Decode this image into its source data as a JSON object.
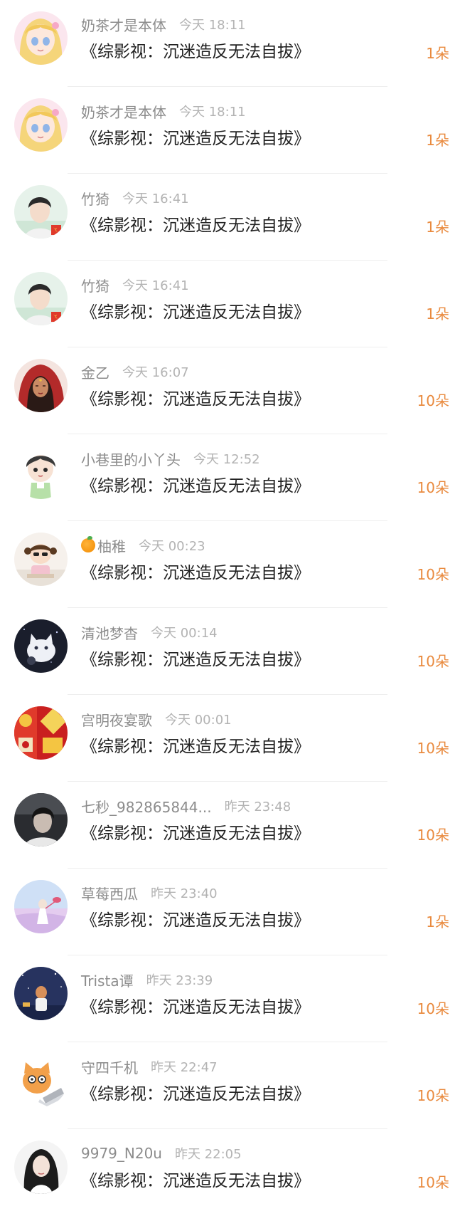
{
  "items": [
    {
      "name": "奶茶才是本体",
      "time": "今天 18:11",
      "title": "《综影视：沉迷造反无法自拔》",
      "gift": "1朵",
      "avatar": "anime-girl-pink"
    },
    {
      "name": "奶茶才是本体",
      "time": "今天 18:11",
      "title": "《综影视：沉迷造反无法自拔》",
      "gift": "1朵",
      "avatar": "anime-girl-pink"
    },
    {
      "name": "竹猗",
      "time": "今天 16:41",
      "title": "《综影视：沉迷造反无法自拔》",
      "gift": "1朵",
      "avatar": "young-man-green"
    },
    {
      "name": "竹猗",
      "time": "今天 16:41",
      "title": "《综影视：沉迷造反无法自拔》",
      "gift": "1朵",
      "avatar": "young-man-green"
    },
    {
      "name": "金乙",
      "time": "今天 16:07",
      "title": "《综影视：沉迷造反无法自拔》",
      "gift": "10朵",
      "avatar": "woman-red-veil"
    },
    {
      "name": "小巷里的小丫头",
      "time": "今天 12:52",
      "title": "《综影视：沉迷造反无法自拔》",
      "gift": "10朵",
      "avatar": "chibi-boy"
    },
    {
      "name": "柚稚",
      "name_emoji": "orange",
      "time": "今天 00:23",
      "title": "《综影视：沉迷造反无法自拔》",
      "gift": "10朵",
      "avatar": "cartoon-girl"
    },
    {
      "name": "清池梦杳",
      "time": "今天 00:14",
      "title": "《综影视：沉迷造反无法自拔》",
      "gift": "10朵",
      "avatar": "white-cat"
    },
    {
      "name": "宫明夜宴歌",
      "time": "今天 00:01",
      "title": "《综影视：沉迷造反无法自拔》",
      "gift": "10朵",
      "avatar": "red-festive"
    },
    {
      "name": "七秒_982865844...",
      "time": "昨天 23:48",
      "title": "《综影视：沉迷造反无法自拔》",
      "gift": "10朵",
      "avatar": "dark-portrait"
    },
    {
      "name": "草莓西瓜",
      "time": "昨天 23:40",
      "title": "《综影视：沉迷造反无法自拔》",
      "gift": "1朵",
      "avatar": "pastel-sky"
    },
    {
      "name": "Trista谭",
      "time": "昨天 23:39",
      "title": "《综影视：沉迷造反无法自拔》",
      "gift": "10朵",
      "avatar": "night-sky-kid"
    },
    {
      "name": "守四千机",
      "time": "昨天 22:47",
      "title": "《综影视：沉迷造反无法自拔》",
      "gift": "10朵",
      "avatar": "cat-laptop"
    },
    {
      "name": "9979_N20u",
      "time": "昨天 22:05",
      "title": "《综影视：沉迷造反无法自拔》",
      "gift": "10朵",
      "avatar": "girl-portrait"
    }
  ],
  "colors": {
    "gift": "#e98a3e",
    "name": "#8c8c8c",
    "time": "#b3b3b3",
    "title": "#222222"
  }
}
